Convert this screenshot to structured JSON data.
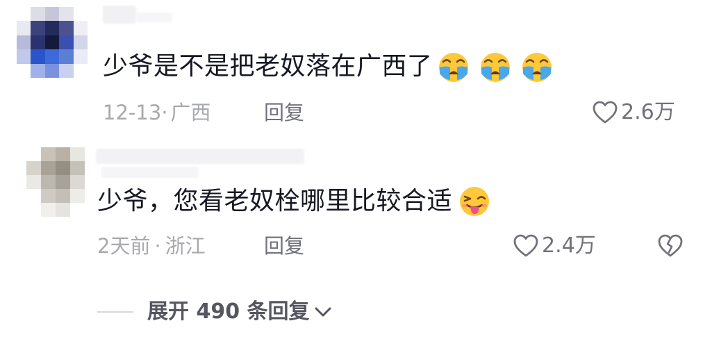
{
  "comments": [
    {
      "text": "少爷是不是把老奴落在广西了",
      "emoji": [
        "loudly-crying-face",
        "loudly-crying-face",
        "loudly-crying-face"
      ],
      "date": "12-13",
      "separator": "·",
      "location": "广西",
      "reply_label": "回复",
      "like_count": "2.6万",
      "liked": false
    },
    {
      "text": "少爷，您看老奴栓哪里比较合适",
      "emoji": [
        "winking-face-with-tongue"
      ],
      "date": "2天前",
      "separator": "·",
      "location": "浙江",
      "reply_label": "回复",
      "like_count": "2.4万",
      "liked": false,
      "has_dislike": true
    }
  ],
  "expand_replies": {
    "label": "展开 490 条回复",
    "icon": "chevron-down-icon"
  },
  "colors": {
    "text_primary": "#161823",
    "text_meta": "#a8a9ad",
    "text_action": "#70717a",
    "emoji_yellow": "#ffc83a",
    "tear_blue": "#4aa8ea"
  }
}
